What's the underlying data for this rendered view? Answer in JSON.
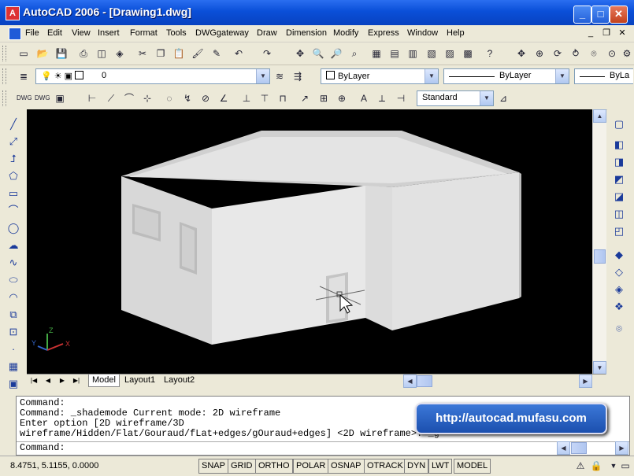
{
  "window": {
    "title": "AutoCAD 2006 - [Drawing1.dwg]",
    "app_icon": "A",
    "minimize": "_",
    "maximize": "□",
    "close": "✕"
  },
  "menu": {
    "items": [
      "File",
      "Edit",
      "View",
      "Insert",
      "Format",
      "Tools",
      "DWGgateway",
      "Draw",
      "Dimension",
      "Modify",
      "Express",
      "Window",
      "Help"
    ],
    "mdi_min": "_",
    "mdi_restore": "❐",
    "mdi_close": "✕"
  },
  "layers": {
    "current_layer": "0",
    "color": "ByLayer",
    "linetype": "ByLayer",
    "lineweight": "ByLa"
  },
  "styles": {
    "text_style": "Standard"
  },
  "tabs": {
    "items": [
      "Model",
      "Layout1",
      "Layout2"
    ],
    "active": "Model"
  },
  "command": {
    "lines": [
      "Command:",
      "Command: _shademode Current mode: 2D wireframe",
      "Enter option [2D wireframe/3D",
      "wireframe/Hidden/Flat/Gouraud/fLat+edges/gOuraud+edges] <2D wireframe>: _g"
    ],
    "prompt": "Command:"
  },
  "watermark": "http://autocad.mufasu.com",
  "ucs": {
    "x": "X",
    "y": "Y",
    "z": "Z"
  },
  "status": {
    "coords": "8.4751, 5.1155, 0.0000",
    "toggles": [
      "SNAP",
      "GRID",
      "ORTHO",
      "POLAR",
      "OSNAP",
      "OTRACK",
      "DYN",
      "LWT",
      "MODEL"
    ]
  },
  "colors": {
    "viewport_bg": "#000000",
    "title_blue": "#0a4fd8",
    "model_face_front": "#e6e6e6",
    "model_face_top": "#d4d4d4",
    "model_face_side": "#bcbcbc"
  }
}
